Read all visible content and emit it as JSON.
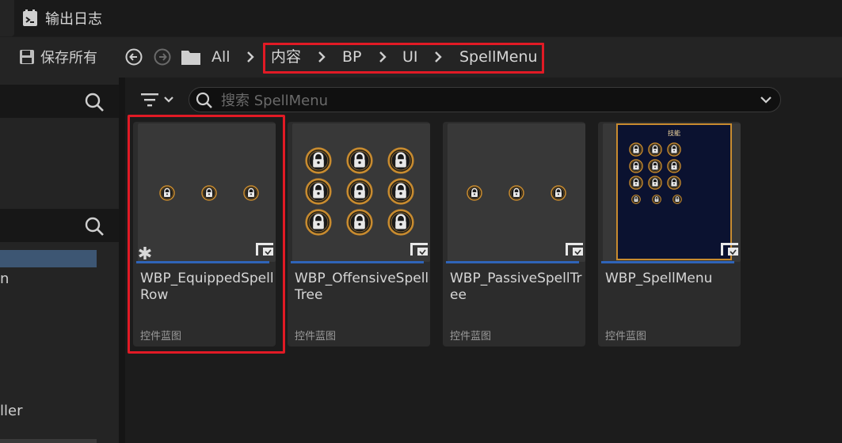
{
  "tabs": {
    "output_log": "输出日志"
  },
  "toolbar": {
    "save_all": "保存所有",
    "breadcrumb": [
      "All",
      "内容",
      "BP",
      "UI",
      "SpellMenu"
    ]
  },
  "sidebar": {
    "partial_text_1": "n",
    "partial_text_2": "ller"
  },
  "search": {
    "placeholder": "搜索 SpellMenu"
  },
  "assets": [
    {
      "name": "WBP_EquippedSpellRow",
      "type": "控件蓝图",
      "selected": true
    },
    {
      "name": "WBP_OffensiveSpellTree",
      "type": "控件蓝图",
      "selected": false
    },
    {
      "name": "WBP_PassiveSpellTree",
      "type": "控件蓝图",
      "selected": false
    },
    {
      "name": "WBP_SpellMenu",
      "type": "控件蓝图",
      "selected": false
    }
  ],
  "spellmenu_thumb_title": "技能",
  "colors": {
    "highlight_red": "#e11a25",
    "asset_accent": "#2f64b8",
    "lock_gold": "#c88b2f"
  }
}
